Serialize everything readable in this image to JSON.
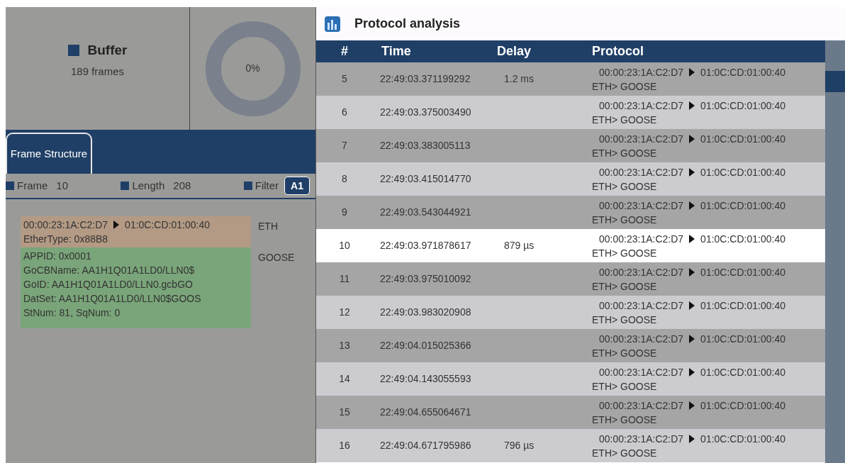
{
  "buffer": {
    "title": "Buffer",
    "frames": "189 frames",
    "gauge": {
      "label": "0%",
      "level": 0
    }
  },
  "tabs": [
    {
      "label": "Frame Structure",
      "selected": true
    }
  ],
  "info": {
    "frame_label": "Frame",
    "frame_value": "10",
    "length_label": "Length",
    "length_value": "208",
    "filter_label": "Filter",
    "filter_value": "A1"
  },
  "structure": [
    {
      "kind": "eth",
      "lines": [
        "00:00:23:1A:C2:D7",
        "01:0C:CD:01:00:40",
        "EtherType: 0x88B8"
      ],
      "layer": "ETH"
    },
    {
      "kind": "goose",
      "lines": [
        "APPID: 0x0001",
        "GoCBName: AA1H1Q01A1LD0/LLN0$",
        "GoID: AA1H1Q01A1LD0/LLN0.gcbGO",
        "DatSet: AA1H1Q01A1LD0/LLN0$GOOS",
        "StNum: 81, SqNum: 0"
      ],
      "layer": "GOOSE"
    }
  ],
  "window": {
    "title": "Protocol analysis"
  },
  "table": {
    "columns": [
      "#",
      "Time",
      "Delay",
      "Protocol"
    ],
    "rows": [
      {
        "n": "5",
        "time": "22:49:03.371199292",
        "delay": "1.2 ms",
        "src": "00:00:23:1A:C2:D7",
        "dst": "01:0C:CD:01:00:40",
        "proto": "ETH> GOOSE",
        "selected": false
      },
      {
        "n": "6",
        "time": "22:49:03.375003490",
        "src": "00:00:23:1A:C2:D7",
        "dst": "01:0C:CD:01:00:40",
        "proto": "ETH> GOOSE",
        "selected": false
      },
      {
        "n": "7",
        "time": "22:49:03.383005113",
        "src": "00:00:23:1A:C2:D7",
        "dst": "01:0C:CD:01:00:40",
        "proto": "ETH> GOOSE",
        "selected": false
      },
      {
        "n": "8",
        "time": "22:49:03.415014770",
        "src": "00:00:23:1A:C2:D7",
        "dst": "01:0C:CD:01:00:40",
        "proto": "ETH> GOOSE",
        "selected": false
      },
      {
        "n": "9",
        "time": "22:49:03.543044921",
        "src": "00:00:23:1A:C2:D7",
        "dst": "01:0C:CD:01:00:40",
        "proto": "ETH> GOOSE",
        "selected": false
      },
      {
        "n": "10",
        "time": "22:49:03.971878617",
        "delay": "879 µs",
        "src": "00:00:23:1A:C2:D7",
        "dst": "01:0C:CD:01:00:40",
        "proto": "ETH> GOOSE",
        "selected": true
      },
      {
        "n": "11",
        "time": "22:49:03.975010092",
        "src": "00:00:23:1A:C2:D7",
        "dst": "01:0C:CD:01:00:40",
        "proto": "ETH> GOOSE",
        "selected": false
      },
      {
        "n": "12",
        "time": "22:49:03.983020908",
        "src": "00:00:23:1A:C2:D7",
        "dst": "01:0C:CD:01:00:40",
        "proto": "ETH> GOOSE",
        "selected": false
      },
      {
        "n": "13",
        "time": "22:49:04.015025366",
        "src": "00:00:23:1A:C2:D7",
        "dst": "01:0C:CD:01:00:40",
        "proto": "ETH> GOOSE",
        "selected": false
      },
      {
        "n": "14",
        "time": "22:49:04.143055593",
        "src": "00:00:23:1A:C2:D7",
        "dst": "01:0C:CD:01:00:40",
        "proto": "ETH> GOOSE",
        "selected": false
      },
      {
        "n": "15",
        "time": "22:49:04.655064671",
        "src": "00:00:23:1A:C2:D7",
        "dst": "01:0C:CD:01:00:40",
        "proto": "ETH> GOOSE",
        "selected": false
      },
      {
        "n": "16",
        "time": "22:49:04.671795986",
        "delay": "796 µs",
        "src": "00:00:23:1A:C2:D7",
        "dst": "01:0C:CD:01:00:40",
        "proto": "ETH> GOOSE",
        "selected": false
      }
    ]
  }
}
